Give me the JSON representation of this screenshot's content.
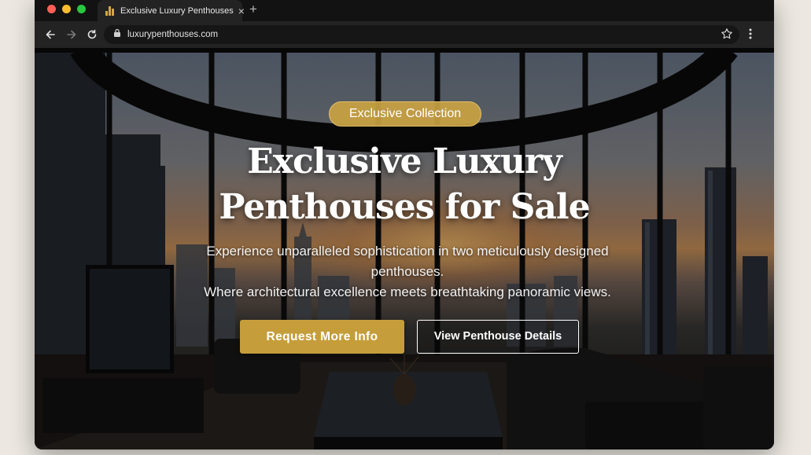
{
  "browser": {
    "tab": {
      "title": "Exclusive Luxury Penthouses"
    },
    "url": "luxurypenthouses.com"
  },
  "hero": {
    "badge": "Exclusive Collection",
    "headline_line1": "Exclusive Luxury",
    "headline_line2": "Penthouses for Sale",
    "subtitle_line1": "Experience unparalleled sophistication in two meticulously designed",
    "subtitle_line2": "penthouses.",
    "subtitle_line3": "Where architectural excellence meets breathtaking panoramic views.",
    "primary_button": "Request More Info",
    "secondary_button": "View Penthouse Details"
  },
  "colors": {
    "accent_gold": "#c59d3a",
    "browser_chrome": "#232323"
  }
}
